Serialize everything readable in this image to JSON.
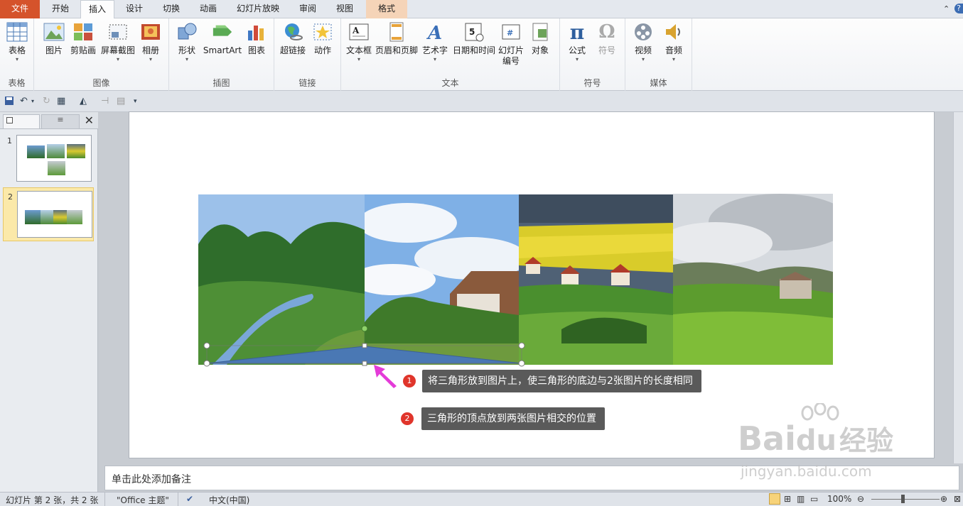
{
  "tabs": [
    "文件",
    "开始",
    "插入",
    "设计",
    "切换",
    "动画",
    "幻灯片放映",
    "审阅",
    "视图",
    "格式"
  ],
  "active_tab": "插入",
  "ribbon": {
    "groups": {
      "table": "表格",
      "images": "图像",
      "illustrations": "插图",
      "links": "链接",
      "text": "文本",
      "symbols": "符号",
      "media": "媒体"
    },
    "buttons": {
      "table": "表格",
      "picture": "图片",
      "clipart": "剪贴画",
      "screenshot": "屏幕截图",
      "album": "相册",
      "shapes": "形状",
      "smartart": "SmartArt",
      "chart": "图表",
      "hyperlink": "超链接",
      "action": "动作",
      "textbox": "文本框",
      "header_footer": "页眉和页脚",
      "wordart": "艺术字",
      "datetime": "日期和时间",
      "slide_number_1": "幻灯片",
      "slide_number_2": "编号",
      "object": "对象",
      "equation": "公式",
      "symbol": "符号",
      "video": "视频",
      "audio": "音频"
    },
    "dropdown_arrow": "▾"
  },
  "slides_panel": {
    "close": "✕",
    "outline_tab_icon": "≡",
    "slides": [
      {
        "num": "1"
      },
      {
        "num": "2"
      }
    ],
    "selected": "2"
  },
  "callouts": [
    {
      "num": "1",
      "text": "将三角形放到图片上，使三角形的底边与2张图片的长度相同"
    },
    {
      "num": "2",
      "text": "三角形的顶点放到两张图片相交的位置"
    }
  ],
  "notes_placeholder": "单击此处添加备注",
  "status": {
    "slide_info": "幻灯片 第 2 张，共 2 张",
    "theme": "\"Office 主题\"",
    "language": "中文(中国)",
    "zoom": "100%"
  },
  "watermark": {
    "brand": "Bai",
    "brand2": "du",
    "cn": "经验",
    "url": "jingyan.baidu.com"
  },
  "colors": {
    "file_tab": "#d5532b",
    "triangle": "#4a78b4",
    "badge": "#e0352b",
    "callout_bg": "#5a5a5a",
    "arrow": "#e43bd8"
  }
}
